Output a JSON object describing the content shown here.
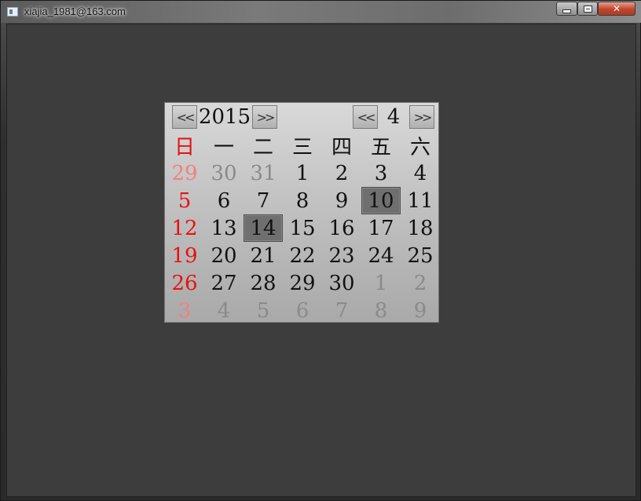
{
  "window": {
    "title": "xiajia_1981@163.com",
    "controls": [
      "minimize",
      "maximize",
      "close"
    ]
  },
  "calendar": {
    "year": "2015",
    "month": "4",
    "prev_year_label": "<<",
    "next_year_label": ">>",
    "prev_month_label": "<<",
    "next_month_label": ">>",
    "weekdays": [
      "日",
      "一",
      "二",
      "三",
      "四",
      "五",
      "六"
    ],
    "weeks": [
      [
        {
          "d": "29",
          "o": 1
        },
        {
          "d": "30",
          "o": 1
        },
        {
          "d": "31",
          "o": 1
        },
        {
          "d": "1"
        },
        {
          "d": "2"
        },
        {
          "d": "3"
        },
        {
          "d": "4"
        }
      ],
      [
        {
          "d": "5"
        },
        {
          "d": "6"
        },
        {
          "d": "7"
        },
        {
          "d": "8"
        },
        {
          "d": "9"
        },
        {
          "d": "10",
          "sel": 1
        },
        {
          "d": "11"
        }
      ],
      [
        {
          "d": "12"
        },
        {
          "d": "13"
        },
        {
          "d": "14",
          "sel": 1
        },
        {
          "d": "15"
        },
        {
          "d": "16"
        },
        {
          "d": "17"
        },
        {
          "d": "18"
        }
      ],
      [
        {
          "d": "19"
        },
        {
          "d": "20"
        },
        {
          "d": "21"
        },
        {
          "d": "22"
        },
        {
          "d": "23"
        },
        {
          "d": "24"
        },
        {
          "d": "25"
        }
      ],
      [
        {
          "d": "26"
        },
        {
          "d": "27"
        },
        {
          "d": "28"
        },
        {
          "d": "29"
        },
        {
          "d": "30"
        },
        {
          "d": "1",
          "o": 1
        },
        {
          "d": "2",
          "o": 1
        }
      ],
      [
        {
          "d": "3",
          "o": 1
        },
        {
          "d": "4",
          "o": 1
        },
        {
          "d": "5",
          "o": 1
        },
        {
          "d": "6",
          "o": 1
        },
        {
          "d": "7",
          "o": 1
        },
        {
          "d": "8",
          "o": 1
        },
        {
          "d": "9",
          "o": 1
        }
      ]
    ],
    "colors": {
      "sunday": "#e81010",
      "sunday_other_month": "#f08080",
      "other_month": "#8a8a8a",
      "selected_bg": "#6f6f6f"
    }
  }
}
